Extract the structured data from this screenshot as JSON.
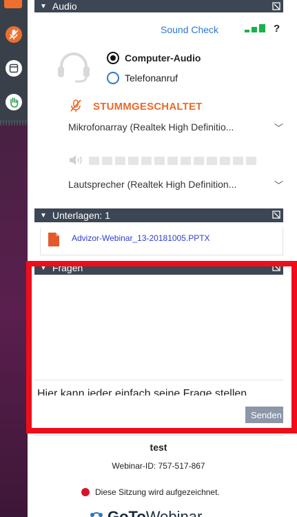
{
  "colors": {
    "header_bg": "#3c4654",
    "link_blue": "#2a78d0",
    "muted_orange": "#ea6a2a",
    "signal_green": "#18b24a",
    "highlight_red": "#ef0d19",
    "record_red": "#d8102e",
    "send_button": "#8c97a8"
  },
  "dock": {
    "icons": [
      "microphone-muted-icon",
      "screen-icon",
      "raise-hand-icon"
    ]
  },
  "audio": {
    "header": "Audio",
    "sound_check": "Sound Check",
    "help": "?",
    "options": [
      {
        "label": "Computer-Audio",
        "selected": true
      },
      {
        "label": "Telefonanruf",
        "selected": false
      }
    ],
    "mute_status": "STUMMGESCHALTET",
    "microphone": "Mikrofonarray (Realtek High Definitio...",
    "speaker_level": 0,
    "speaker": "Lautsprecher (Realtek High Definition..."
  },
  "handouts": {
    "header": "Unterlagen: 1",
    "file": "Advizor-Webinar_13-20181005.PPTX"
  },
  "questions": {
    "header": "Fragen",
    "input_value": "Hier kann jeder einfach seine Frage stellen",
    "send_label": "Senden"
  },
  "footer": {
    "session_name": "test",
    "webinar_id": "Webinar-ID: 757-517-867",
    "recording": "Diese Sitzung wird aufgezeichnet.",
    "brand_bold": "GoTo",
    "brand_light": "Webinar"
  }
}
